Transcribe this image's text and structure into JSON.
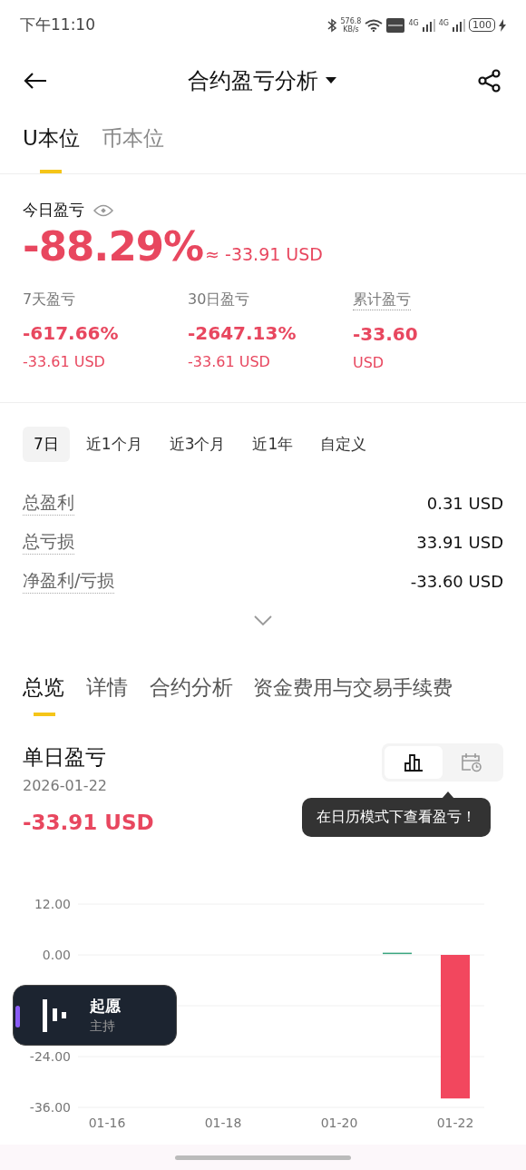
{
  "status_bar": {
    "time": "下午11:10",
    "speed": "576.8",
    "speed_unit": "KB/s",
    "network_1": "4G",
    "network_2": "4G",
    "battery": "100"
  },
  "header": {
    "title": "合约盈亏分析"
  },
  "unit_tabs": [
    {
      "label": "U本位",
      "selected": true
    },
    {
      "label": "币本位",
      "selected": false
    }
  ],
  "today": {
    "label": "今日盈亏",
    "percent": "-88.29%",
    "approx": "≈ -33.91 USD"
  },
  "stats": [
    {
      "label": "7天盈亏",
      "percent": "-617.66%",
      "amount": "-33.61 USD",
      "dotted": false
    },
    {
      "label": "30日盈亏",
      "percent": "-2647.13%",
      "amount": "-33.61 USD",
      "dotted": false
    },
    {
      "label": "累计盈亏",
      "percent": "-33.60",
      "amount": "USD",
      "dotted": true
    }
  ],
  "periods": [
    {
      "label": "7日",
      "selected": true
    },
    {
      "label": "近1个月",
      "selected": false
    },
    {
      "label": "近3个月",
      "selected": false
    },
    {
      "label": "近1年",
      "selected": false
    },
    {
      "label": "自定义",
      "selected": false
    }
  ],
  "totals": [
    {
      "label": "总盈利",
      "value": "0.31 USD"
    },
    {
      "label": "总亏损",
      "value": "33.91 USD"
    },
    {
      "label": "净盈利/亏损",
      "value": "-33.60 USD"
    }
  ],
  "section_tabs": [
    {
      "label": "总览",
      "selected": true
    },
    {
      "label": "详情",
      "selected": false
    },
    {
      "label": "合约分析",
      "selected": false
    },
    {
      "label": "资金费用与交易手续费",
      "selected": false
    }
  ],
  "daily": {
    "title": "单日盈亏",
    "date": "2026-01-22",
    "amount": "-33.91 USD",
    "views": [
      {
        "kind": "bar",
        "selected": true
      },
      {
        "kind": "calendar",
        "selected": false
      }
    ],
    "tooltip": "在日历模式下查看盈亏！",
    "chart_data": {
      "type": "bar",
      "categories": [
        "01-16",
        null,
        "01-18",
        null,
        "01-20",
        null,
        "01-22"
      ],
      "series": [
        {
          "values": [
            0,
            0,
            0,
            0,
            0,
            0.3,
            -33.9
          ]
        }
      ],
      "ylim": [
        -36,
        12
      ],
      "yticks": [
        {
          "value": 12,
          "label": "12.00"
        },
        {
          "value": 0,
          "label": "0.00"
        },
        {
          "value": -24,
          "label": "-24.00"
        },
        {
          "value": -36,
          "label": "-36.00"
        }
      ]
    }
  },
  "floating_widget": {
    "name": "起愿",
    "role": "主持"
  }
}
